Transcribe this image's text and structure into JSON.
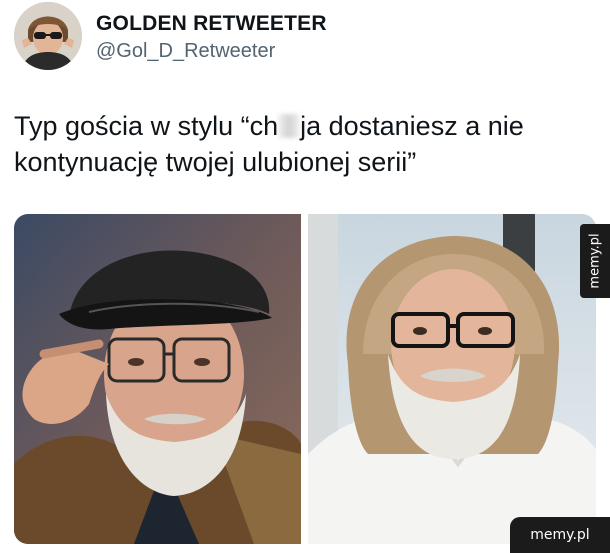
{
  "tweet": {
    "display_name": "GOLDEN RETWEETER",
    "handle": "@Gol_D_Retweeter",
    "text_before": "Typ gościa w stylu “ch",
    "text_after": "ja dostaniesz a nie kontynuację twojej ulubionej serii”",
    "avatar_icon": "avatar-sunglasses-portrait"
  },
  "media": {
    "left_photo": "photo-man-cap-glasses",
    "right_photo": "photo-man-beard-glasses"
  },
  "watermark": {
    "side_text": "memy.pl",
    "corner_text": "memy.pl"
  },
  "colors": {
    "text": "#0f1419",
    "handle": "#536471",
    "watermark_bg": "#1b1b1b"
  }
}
